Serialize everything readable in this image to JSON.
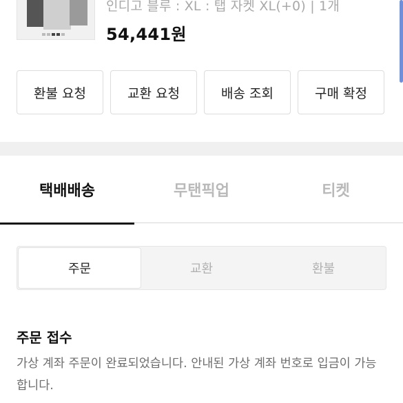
{
  "product": {
    "option_text": "인디고 블루 : XL : 탭 자켓 XL(+0) | 1개",
    "price": "54,441원"
  },
  "actions": [
    {
      "label": "환불 요청"
    },
    {
      "label": "교환 요청"
    },
    {
      "label": "배송 조회"
    },
    {
      "label": "구매 확정"
    }
  ],
  "tabs": [
    {
      "label": "택배배송",
      "active": true
    },
    {
      "label": "무탠픽업",
      "active": false
    },
    {
      "label": "티켓",
      "active": false
    }
  ],
  "segments": [
    {
      "label": "주문",
      "active": true
    },
    {
      "label": "교환",
      "active": false
    },
    {
      "label": "환불",
      "active": false
    }
  ],
  "status": {
    "title": "주문 접수",
    "description": "가상 계좌 주문이 완료되었습니다. 안내된 가상 계좌 번호로 입금이 가능합니다."
  },
  "colors": {
    "accent": "#111111",
    "inactive_tab": "#b9b9b9",
    "scrollbar": "#6f8fd8"
  }
}
